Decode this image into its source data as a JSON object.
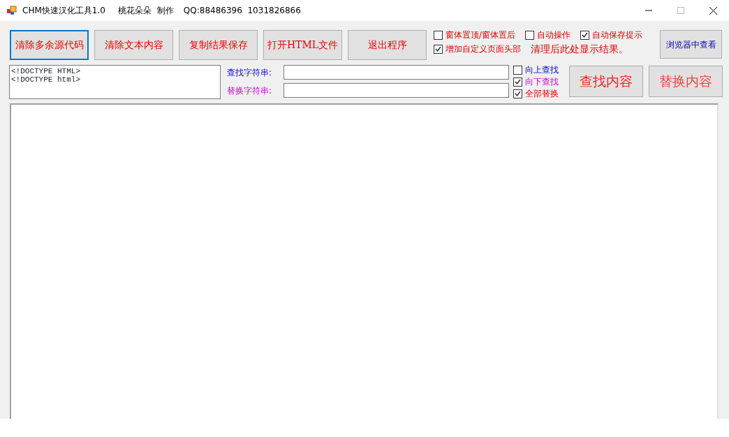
{
  "window": {
    "title": "CHM快速汉化工具1.0",
    "author": "桃花朵朵",
    "author_suffix": "制作",
    "contact": "QQ:88486396  1031826866"
  },
  "toolbar_buttons": [
    {
      "label": "清除多余源代码",
      "focused": true
    },
    {
      "label": "清除文本内容",
      "focused": false
    },
    {
      "label": "复制结果保存",
      "focused": false
    },
    {
      "label": "打开HTML文件",
      "focused": false
    },
    {
      "label": "退出程序",
      "focused": false
    }
  ],
  "options": [
    {
      "label": "窗体置顶/窗体置后",
      "checked": false
    },
    {
      "label": "自动操作",
      "checked": false
    },
    {
      "label": "自动保存提示",
      "checked": true
    },
    {
      "label": "增加自定义页面头部",
      "checked": true
    }
  ],
  "status_message": "清理后此处显示结果。",
  "browser_button": {
    "label": "浏览器中查看"
  },
  "source_text": "<!DOCTYPE HTML>\n<!DOCTYPE html>",
  "find_field": {
    "label": "查找字符串:"
  },
  "replace_field": {
    "label": "替换字符串:"
  },
  "search_options": [
    {
      "label": "向上查找",
      "checked": false
    },
    {
      "label": "向下查找",
      "checked": true
    },
    {
      "label": "全部替换",
      "checked": true
    }
  ],
  "action_buttons": [
    {
      "label": "查找内容",
      "color": "#ee2222"
    },
    {
      "label": "替换内容",
      "color": "#ee4444"
    }
  ]
}
